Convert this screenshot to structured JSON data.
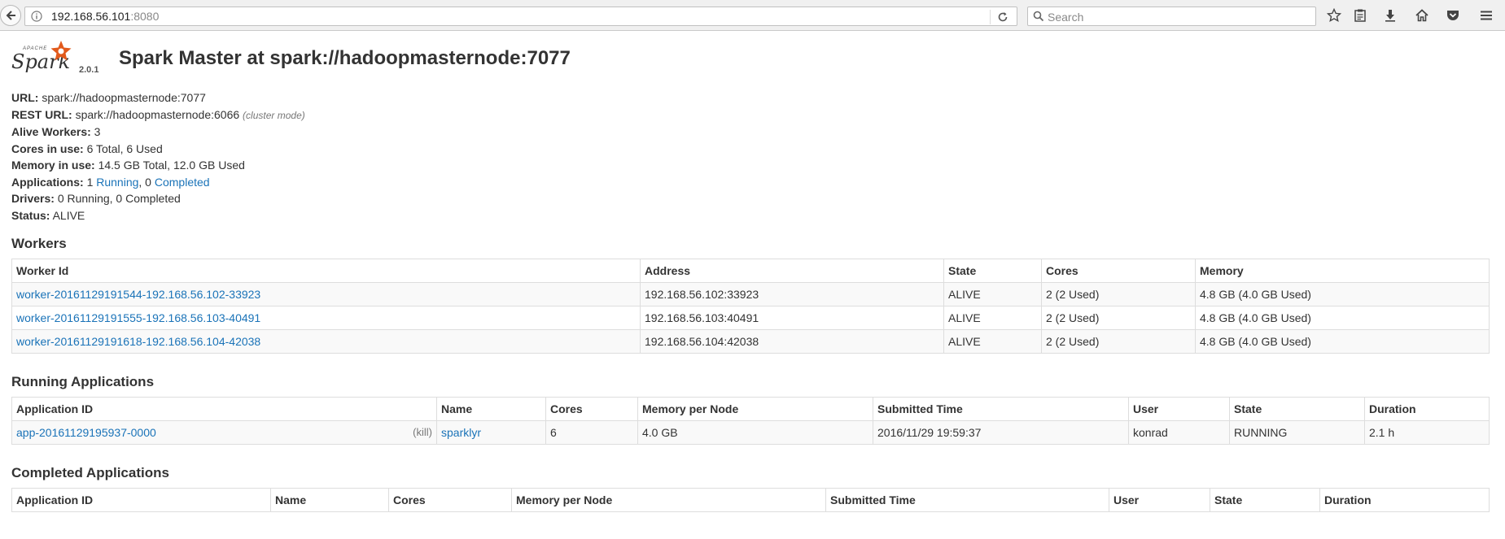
{
  "browser": {
    "url_host": "192.168.56.101",
    "url_port": ":8080",
    "search_placeholder": "Search"
  },
  "header": {
    "logo_apache": "APACHE",
    "logo_word": "Spark",
    "version": "2.0.1",
    "title": "Spark Master at spark://hadoopmasternode:7077"
  },
  "summary": {
    "url_label": "URL:",
    "url_value": "spark://hadoopmasternode:7077",
    "rest_label": "REST URL:",
    "rest_value": "spark://hadoopmasternode:6066",
    "rest_mode": "(cluster mode)",
    "workers_label": "Alive Workers:",
    "workers_value": "3",
    "cores_label": "Cores in use:",
    "cores_value": "6 Total, 6 Used",
    "memory_label": "Memory in use:",
    "memory_value": "14.5 GB Total, 12.0 GB Used",
    "apps_label": "Applications:",
    "apps_running_count": "1",
    "apps_running_link": "Running",
    "apps_sep": ", 0",
    "apps_completed_link": "Completed",
    "drivers_label": "Drivers:",
    "drivers_value": "0 Running, 0 Completed",
    "status_label": "Status:",
    "status_value": "ALIVE"
  },
  "workers": {
    "title": "Workers",
    "columns": [
      "Worker Id",
      "Address",
      "State",
      "Cores",
      "Memory"
    ],
    "rows": [
      [
        "worker-20161129191544-192.168.56.102-33923",
        "192.168.56.102:33923",
        "ALIVE",
        "2 (2 Used)",
        "4.8 GB (4.0 GB Used)"
      ],
      [
        "worker-20161129191555-192.168.56.103-40491",
        "192.168.56.103:40491",
        "ALIVE",
        "2 (2 Used)",
        "4.8 GB (4.0 GB Used)"
      ],
      [
        "worker-20161129191618-192.168.56.104-42038",
        "192.168.56.104:42038",
        "ALIVE",
        "2 (2 Used)",
        "4.8 GB (4.0 GB Used)"
      ]
    ]
  },
  "running": {
    "title": "Running Applications",
    "columns": [
      "Application ID",
      "Name",
      "Cores",
      "Memory per Node",
      "Submitted Time",
      "User",
      "State",
      "Duration"
    ],
    "rows": [
      [
        "app-20161129195937-0000",
        "sparklyr",
        "6",
        "4.0 GB",
        "2016/11/29 19:59:37",
        "konrad",
        "RUNNING",
        "2.1 h"
      ]
    ],
    "kill_label": "(kill)"
  },
  "completed": {
    "title": "Completed Applications",
    "columns": [
      "Application ID",
      "Name",
      "Cores",
      "Memory per Node",
      "Submitted Time",
      "User",
      "State",
      "Duration"
    ]
  }
}
